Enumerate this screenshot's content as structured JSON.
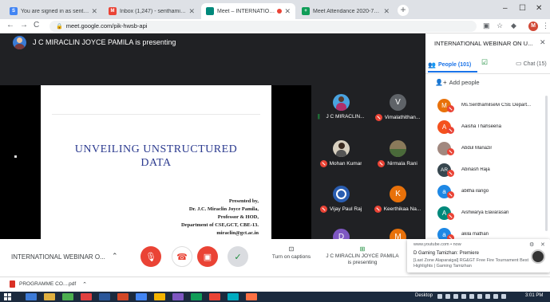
{
  "browser": {
    "tabs": [
      {
        "title": "You are signed in as senthamiz...",
        "favicon": "S",
        "color": "#4285f4",
        "active": false
      },
      {
        "title": "Inbox (1,247) - senthamilselvi.cs...",
        "favicon": "M",
        "color": "#ea4335",
        "active": false
      },
      {
        "title": "Meet – INTERNATIONAL WE...",
        "favicon": "",
        "color": "#00897b",
        "active": true
      },
      {
        "title": "Meet Attendance 2020-7-13 16...",
        "favicon": "+",
        "color": "#0f9d58",
        "active": false
      }
    ],
    "url": "meet.google.com/pik-hwsb-api",
    "profile_initial": "M"
  },
  "meet": {
    "presenter_banner": "J C MIRACLIN JOYCE PAMILA is presenting",
    "slide": {
      "title_line1": "UNVEILING UNSTRUCTURED",
      "title_line2": "DATA",
      "credits": [
        "Presented by,",
        "Dr. J.C. Miraclin Joyce Pamila,",
        "Professor & HOD,",
        "Department of CSE,GCT, CBE-13.",
        "miraclin@gct.ac.in"
      ]
    },
    "tiles": [
      {
        "name": "J C MIRACLIN...",
        "initial": "",
        "color": "#4aa3df",
        "speaking": true
      },
      {
        "name": "Vimalathithan...",
        "initial": "V",
        "color": "#5f6368",
        "speaking": false
      },
      {
        "name": "Mohan Kumar",
        "initial": "",
        "color": "#d8d0c0",
        "speaking": false
      },
      {
        "name": "Nirmala Rani",
        "initial": "",
        "color": "#8a7a5a",
        "speaking": false
      },
      {
        "name": "Vijay Paul Raj",
        "initial": "",
        "color": "#2a5db0",
        "speaking": false
      },
      {
        "name": "Keerthikaa Na...",
        "initial": "K",
        "color": "#e8710a",
        "speaking": false
      },
      {
        "name": "",
        "initial": "D",
        "color": "#7e57c2",
        "speaking": false
      },
      {
        "name": "",
        "initial": "M",
        "color": "#e8710a",
        "speaking": false
      }
    ],
    "panel": {
      "title": "INTERNATIONAL WEBINAR ON U...",
      "people_tab": "People (101)",
      "chat_tab": "Chat (15)",
      "add_people": "Add people",
      "participants": [
        {
          "name": "Ms.Senthamilselvi CSE Depart...",
          "initial": "M",
          "color": "#e8710a"
        },
        {
          "name": "Aaisha Thahseena",
          "initial": "A",
          "color": "#f4511e"
        },
        {
          "name": "Abdul Manazir",
          "initial": "",
          "color": "#a1887f"
        },
        {
          "name": "Abinash Raja",
          "initial": "AR",
          "color": "#37474f"
        },
        {
          "name": "abitha ilango",
          "initial": "a",
          "color": "#1e88e5"
        },
        {
          "name": "Aishwarya Elavarasan",
          "initial": "A",
          "color": "#00897b"
        },
        {
          "name": "akila mathan",
          "initial": "a",
          "color": "#1e88e5"
        }
      ]
    },
    "controls": {
      "meeting_title": "INTERNATIONAL WEBINAR O...",
      "captions_label": "Turn on captions",
      "presenting_line1": "J C MIRACLIN JOYCE PAMILA",
      "presenting_line2": "is presenting"
    },
    "notification": {
      "source": "www.youtube.com • now",
      "title": "D Gaming Tamizhan: Premiere",
      "body": "[Last Zone Alaparaigal] RG&GT Free Fire Tournament Best Highlights | Gaming Tamizhan"
    }
  },
  "download": {
    "filename": "PROGRAMME CO....pdf"
  },
  "taskbar": {
    "desktop_label": "Desktop",
    "time": "3:01 PM"
  }
}
